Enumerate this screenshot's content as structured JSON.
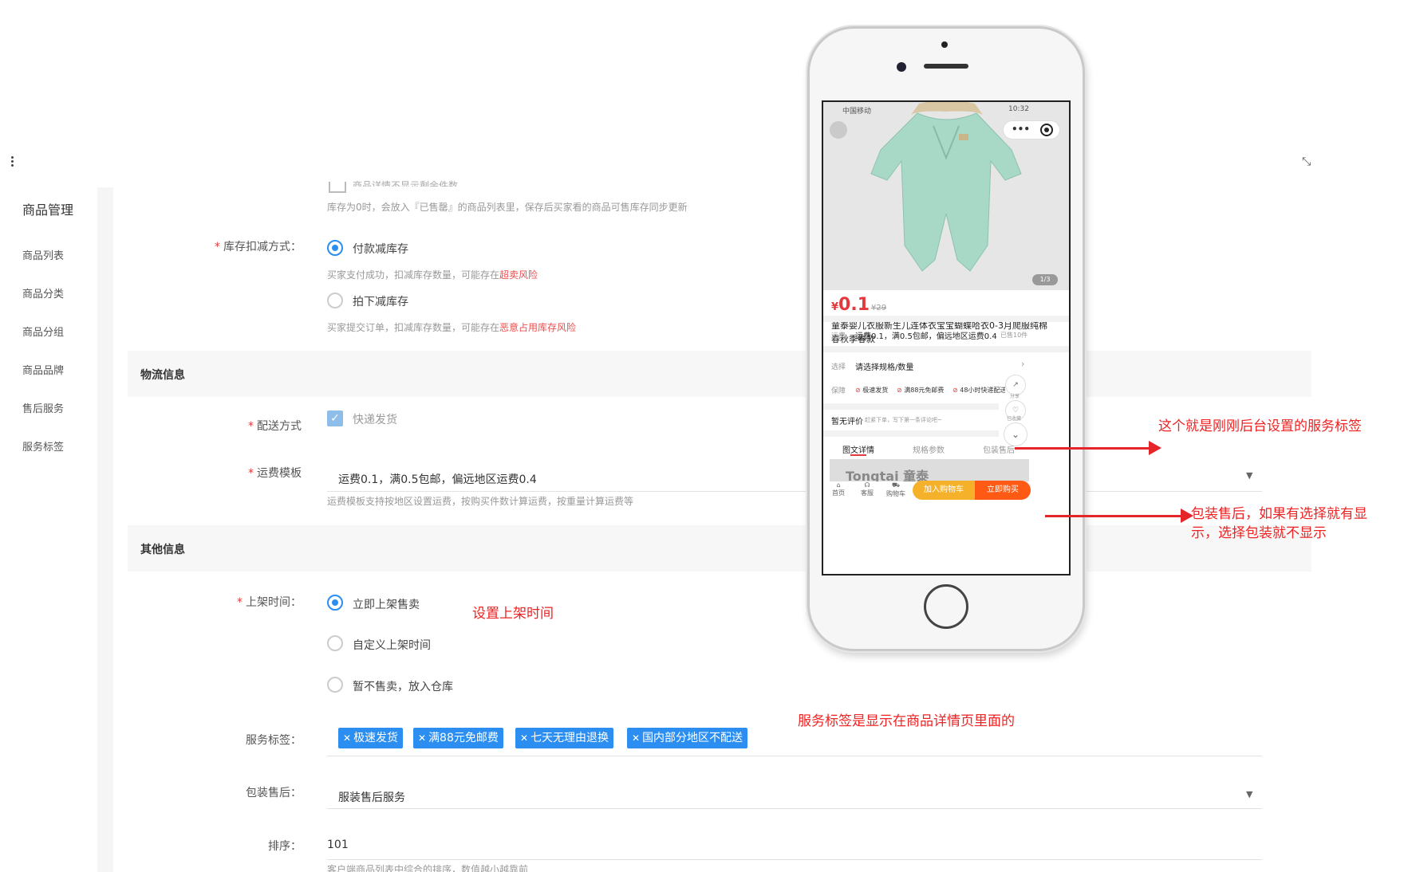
{
  "sidebar": {
    "title": "商品管理",
    "items": [
      "商品列表",
      "商品分类",
      "商品分组",
      "商品品牌",
      "售后服务",
      "服务标签"
    ]
  },
  "form": {
    "top_checkbox_text": "商品详情不显示剩余件数",
    "stock_note": "库存为0时，会放入『已售罄』的商品列表里，保存后买家看的商品可售库存同步更新",
    "stock_method": {
      "label": "库存扣减方式：",
      "option1": "付款减库存",
      "option1_help": "买家支付成功，扣减库存数量，可能存在",
      "option1_risk": "超卖风险",
      "option2": "拍下减库存",
      "option2_help": "买家提交订单，扣减库存数量，可能存在",
      "option2_risk": "恶意占用库存风险"
    },
    "logistics": {
      "section": "物流信息",
      "delivery_label": "配送方式",
      "delivery_option": "快递发货",
      "template_label": "运费模板",
      "template_value": "运费0.1，满0.5包邮，偏远地区运费0.4",
      "template_help": "运费模板支持按地区设置运费，按购买件数计算运费，按重量计算运费等"
    },
    "other": {
      "section": "其他信息",
      "shelf_label": "上架时间：",
      "shelf_options": [
        "立即上架售卖",
        "自定义上架时间",
        "暂不售卖，放入仓库"
      ],
      "service_label": "服务标签：",
      "service_tags": [
        "极速发货",
        "满88元免邮费",
        "七天无理由退换",
        "国内部分地区不配送"
      ],
      "after_sale_label": "包装售后：",
      "after_sale_value": "服装售后服务",
      "sort_label": "排序：",
      "sort_value": "101",
      "sort_help": "客户端商品列表中综合的排序，数值越小越靠前"
    }
  },
  "annotations": {
    "shelf_note": "设置上架时间",
    "service_note": "服务标签是显示在商品详情页里面的",
    "right_note1": "这个就是刚刚后台设置的服务标签",
    "right_note2_line1": "包装售后，如果有选择就有显",
    "right_note2_line2": "示，选择包装就不显示"
  },
  "phone": {
    "status_left": "中国移动",
    "status_right": "10:32",
    "pager": "1/3",
    "price_symbol": "¥",
    "price": "0.1",
    "old_price": "¥29",
    "title": "童泰婴儿衣服新生儿连体衣宝宝蝴蝶哈衣0-3月爬服纯棉春秋季春款",
    "freight_label": "运费",
    "freight_value": "运费0.1，满0.5包邮，偏远地区运费0.4",
    "sold": "已售10件",
    "choose_label": "选择",
    "choose_value": "请选择规格/数量",
    "guarantee_label": "保障",
    "guarantees": [
      "极速发货",
      "满88元免邮费",
      "48小时快递配送"
    ],
    "share_label": "分享",
    "fav_label": "已收藏",
    "review_label": "暂无评价",
    "review_hint": "赶紧下单，写下第一条评论吧~",
    "tabs": [
      "图文详情",
      "规格参数",
      "包装售后"
    ],
    "banner_text": "Tongtai 童泰",
    "tabbar": [
      "首页",
      "客服",
      "购物车"
    ],
    "cart_btn": "加入购物车",
    "buy_btn": "立即购买"
  }
}
